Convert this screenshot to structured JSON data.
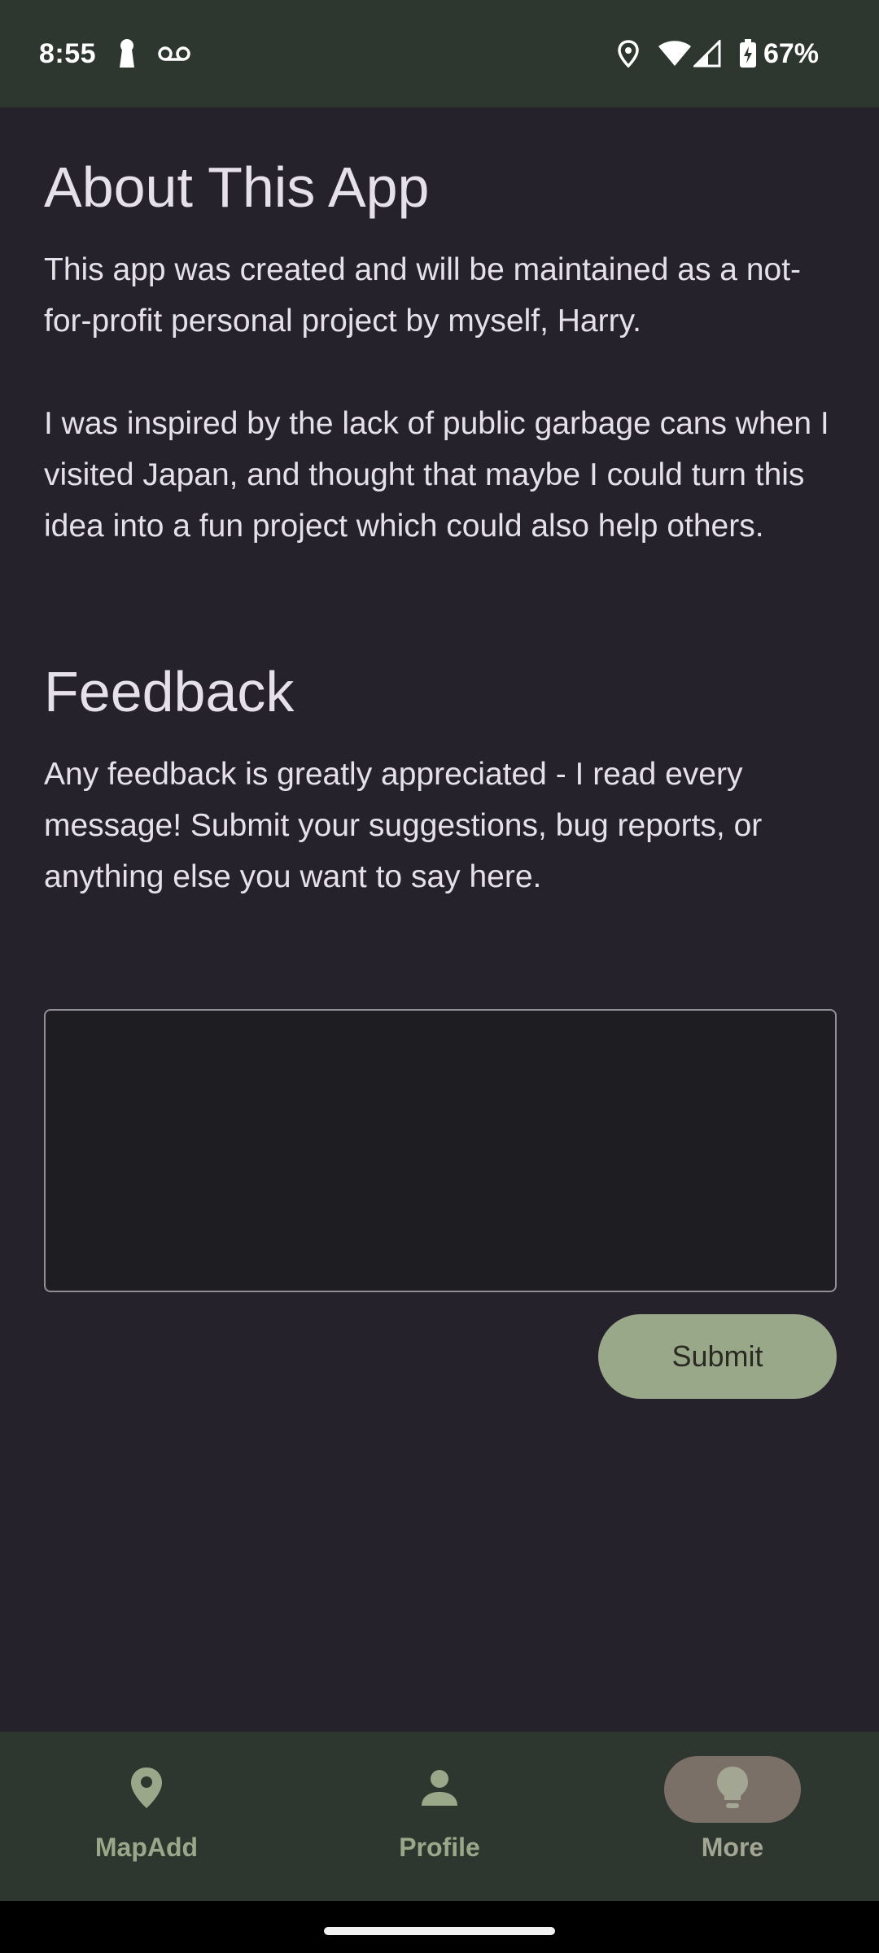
{
  "status_bar": {
    "time": "8:55",
    "battery": "67%",
    "icons": [
      "keyhole-icon",
      "voicemail-icon",
      "location-icon",
      "wifi-icon",
      "signal-icon",
      "battery-charging-icon"
    ]
  },
  "about": {
    "title": "About This App",
    "paragraph1": "This app was created and will be maintained as a not-for-profit personal project by myself, Harry.",
    "paragraph2": "I was inspired by the lack of public garbage cans when I visited Japan, and thought that maybe I could turn this idea into a fun project which could also help others."
  },
  "feedback": {
    "title": "Feedback",
    "description": "Any feedback is greatly appreciated - I read every message! Submit your suggestions, bug reports, or anything else you want to say here.",
    "input_value": "",
    "submit_label": "Submit"
  },
  "bottom_nav": {
    "items": [
      {
        "label": "MapAdd",
        "icon": "map-pin-icon",
        "active": false
      },
      {
        "label": "Profile",
        "icon": "person-icon",
        "active": false
      },
      {
        "label": "More",
        "icon": "lightbulb-icon",
        "active": true
      }
    ]
  },
  "colors": {
    "background": "#25222b",
    "bars": "#2e3630",
    "accent": "#9aa88a",
    "active_indicator": "#7b7068"
  }
}
